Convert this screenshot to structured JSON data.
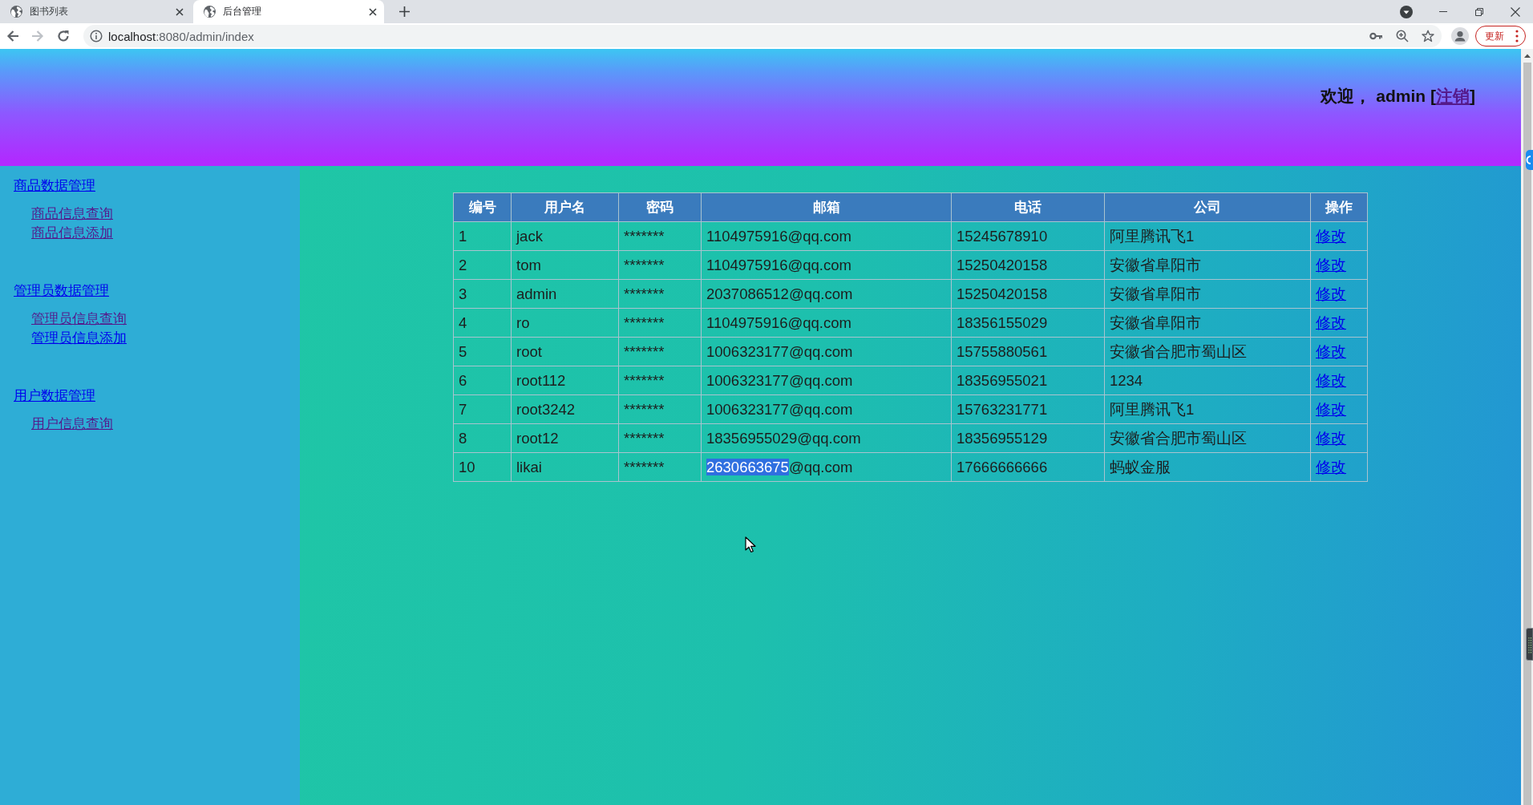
{
  "browser": {
    "tabs": [
      {
        "title": "图书列表",
        "selected": false
      },
      {
        "title": "后台管理",
        "selected": true
      }
    ],
    "address": {
      "host": "localhost",
      "path": ":8080/admin/index"
    },
    "update_button": "更新"
  },
  "header": {
    "welcome_before": "欢迎， admin [",
    "logout": {
      "label": "注销",
      "visited": true
    },
    "welcome_after": "]"
  },
  "sidebar": {
    "groups": [
      {
        "label": "商品数据管理",
        "visited": false,
        "children": [
          {
            "label": "商品信息查询",
            "visited": true
          },
          {
            "label": "商品信息添加",
            "visited": true
          }
        ]
      },
      {
        "label": "管理员数据管理",
        "visited": false,
        "children": [
          {
            "label": "管理员信息查询",
            "visited": true
          },
          {
            "label": "管理员信息添加",
            "visited": false
          }
        ]
      },
      {
        "label": "用户数据管理",
        "visited": false,
        "children": [
          {
            "label": "用户信息查询",
            "visited": true
          }
        ]
      }
    ]
  },
  "table": {
    "columns": [
      "编号",
      "用户名",
      "密码",
      "邮箱",
      "电话",
      "公司",
      "操作"
    ],
    "rows": [
      {
        "cells": [
          "1",
          "jack",
          "*******",
          "1104975916@qq.com",
          "15245678910",
          "阿里腾讯飞1"
        ],
        "action": {
          "label": "修改",
          "visited": false
        }
      },
      {
        "cells": [
          "2",
          "tom",
          "*******",
          "1104975916@qq.com",
          "15250420158",
          "安徽省阜阳市"
        ],
        "action": {
          "label": "修改",
          "visited": false
        }
      },
      {
        "cells": [
          "3",
          "admin",
          "*******",
          "2037086512@qq.com",
          "15250420158",
          "安徽省阜阳市"
        ],
        "action": {
          "label": "修改",
          "visited": false
        }
      },
      {
        "cells": [
          "4",
          "ro",
          "*******",
          "1104975916@qq.com",
          "18356155029",
          "安徽省阜阳市"
        ],
        "action": {
          "label": "修改",
          "visited": false
        }
      },
      {
        "cells": [
          "5",
          "root",
          "*******",
          "1006323177@qq.com",
          "15755880561",
          "安徽省合肥市蜀山区"
        ],
        "action": {
          "label": "修改",
          "visited": false
        }
      },
      {
        "cells": [
          "6",
          "root112",
          "*******",
          "1006323177@qq.com",
          "18356955021",
          "1234"
        ],
        "action": {
          "label": "修改",
          "visited": false
        }
      },
      {
        "cells": [
          "7",
          "root3242",
          "*******",
          "1006323177@qq.com",
          "15763231771",
          "阿里腾讯飞1"
        ],
        "action": {
          "label": "修改",
          "visited": false
        }
      },
      {
        "cells": [
          "8",
          "root12",
          "*******",
          "18356955029@qq.com",
          "18356955129",
          "安徽省合肥市蜀山区"
        ],
        "action": {
          "label": "修改",
          "visited": false
        }
      },
      {
        "cells": [
          "10",
          "likai",
          "*******",
          {
            "segments": [
              {
                "text": "2630663675",
                "highlighted": true
              },
              {
                "text": "@qq.com",
                "highlighted": false
              }
            ]
          },
          "17666666666",
          "蚂蚁金服"
        ],
        "action": {
          "label": "修改",
          "visited": false
        }
      }
    ]
  }
}
